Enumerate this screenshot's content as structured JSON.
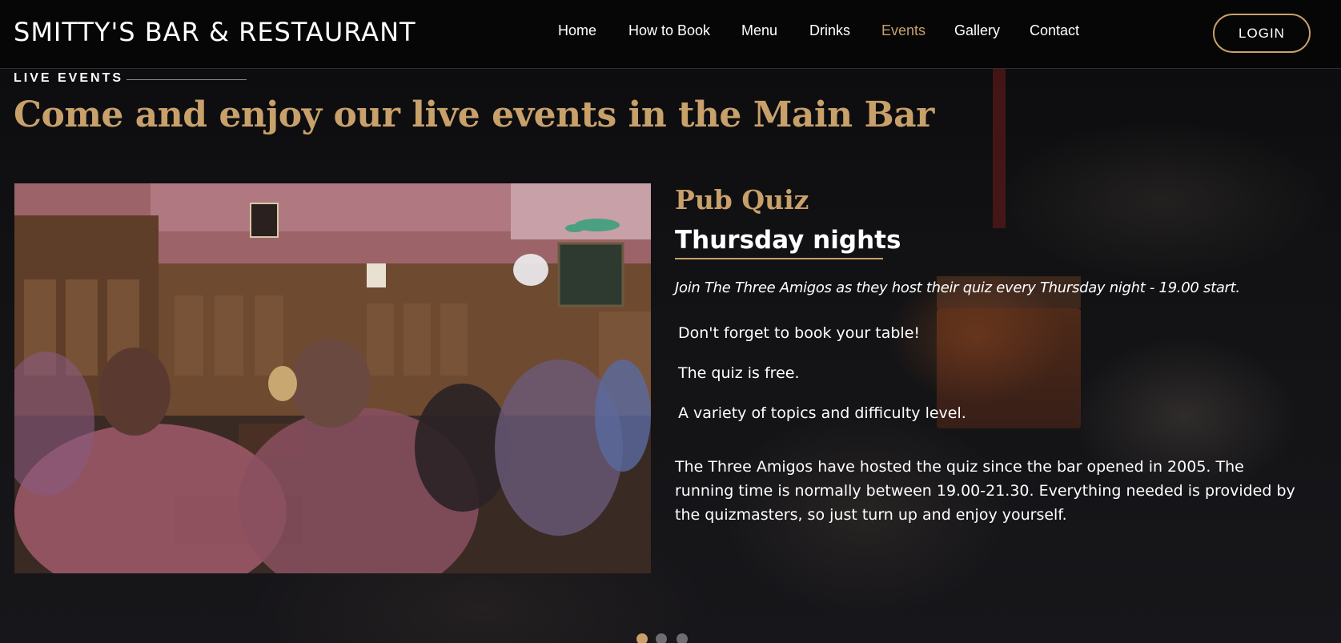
{
  "header": {
    "brand": "SMITTY'S BAR & RESTAURANT",
    "nav": [
      {
        "label": "Home"
      },
      {
        "label": "How to Book"
      },
      {
        "label": "Menu"
      },
      {
        "label": "Drinks"
      },
      {
        "label": "Events",
        "active": true
      },
      {
        "label": "Gallery"
      },
      {
        "label": "Contact"
      }
    ],
    "login_label": "LOGIN"
  },
  "section": {
    "eyebrow": "LIVE EVENTS",
    "headline": "Come and enjoy our live events in the Main Bar"
  },
  "event": {
    "title": "Pub Quiz",
    "subtitle": "Thursday nights",
    "intro": "Join The Three Amigos as they host their quiz every Thursday night - 19.00 start.",
    "points": [
      "Don't forget to book your table!",
      "The quiz is free.",
      "A variety of topics and difficulty level."
    ],
    "description": "The Three Amigos have hosted the quiz since the bar opened in 2005. The running time is normally between 19.00-21.30. Everything needed is provided by the quizmasters, so just turn up and enjoy yourself."
  },
  "carousel": {
    "slides": 3,
    "active_index": 0
  },
  "colors": {
    "accent": "#c8a06a",
    "background": "#08080a",
    "text": "#ffffff"
  }
}
